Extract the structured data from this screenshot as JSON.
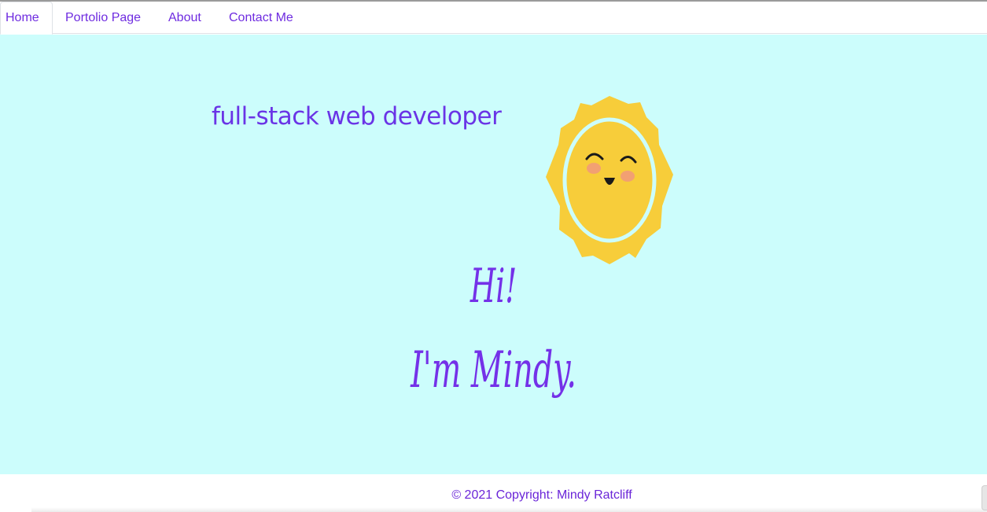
{
  "nav": {
    "tabs": [
      {
        "label": "Home"
      },
      {
        "label": "Portolio Page"
      },
      {
        "label": "About"
      },
      {
        "label": "Contact Me"
      }
    ],
    "active_tab": "Home",
    "link_color": "#6f2ce0"
  },
  "hero": {
    "tagline": "full-stack web developer",
    "greeting_line1": "Hi!",
    "greeting_line2": "I'm Mindy.",
    "background_color": "#ccfdfc",
    "text_color": "#6a34e6",
    "illustration": "smiling-sun-icon"
  },
  "footer": {
    "copyright": "© 2021 Copyright: Mindy Ratcliff"
  }
}
